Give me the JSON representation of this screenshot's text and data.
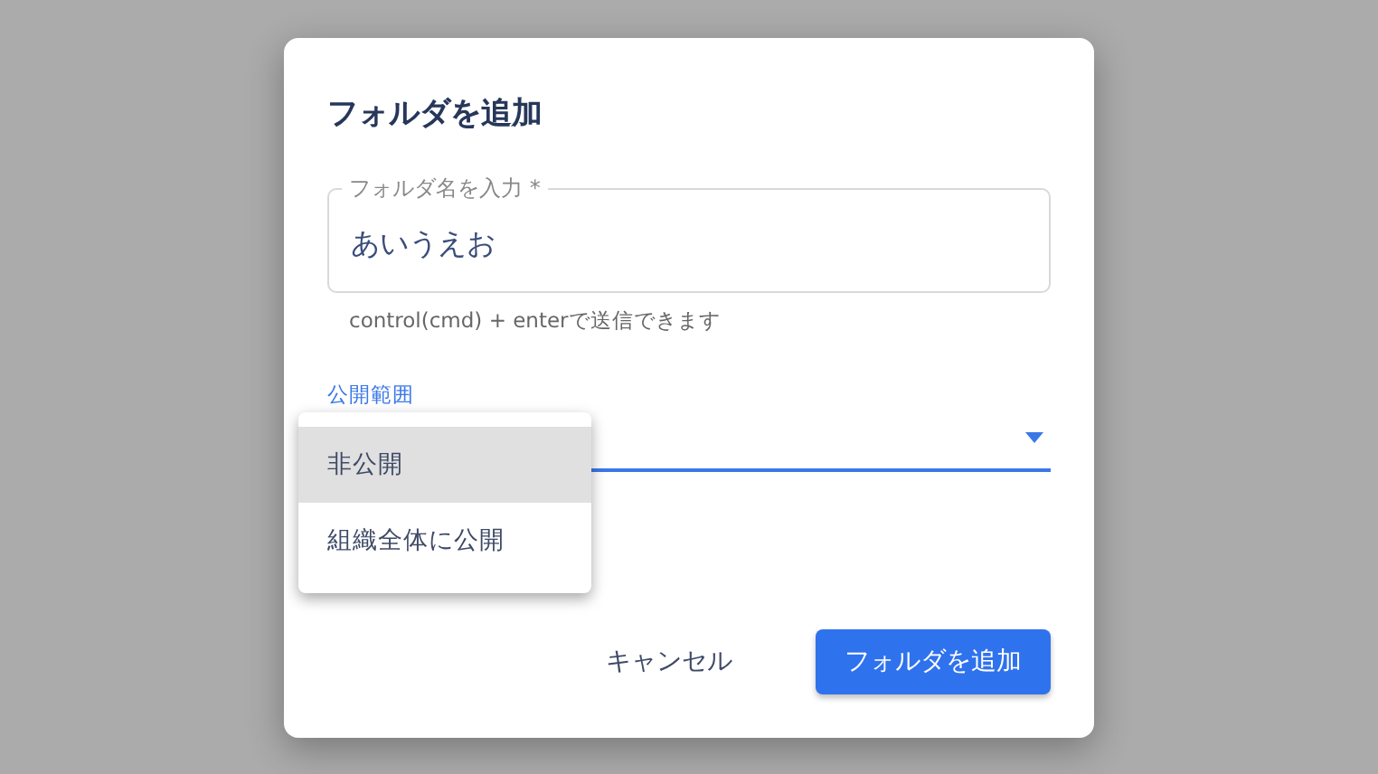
{
  "dialog": {
    "title": "フォルダを追加",
    "name_field": {
      "label": "フォルダ名を入力 *",
      "value": "あいうえお",
      "helper": "control(cmd) + enterで送信できます"
    },
    "visibility_select": {
      "label": "公開範囲",
      "expanded": true
    },
    "menu": [
      {
        "label": "非公開",
        "selected": true
      },
      {
        "label": "組織全体に公開",
        "selected": false
      }
    ],
    "buttons": [
      {
        "label": "キャンセル",
        "kind": "text"
      },
      {
        "label": "フォルダを追加",
        "kind": "primary"
      }
    ]
  }
}
